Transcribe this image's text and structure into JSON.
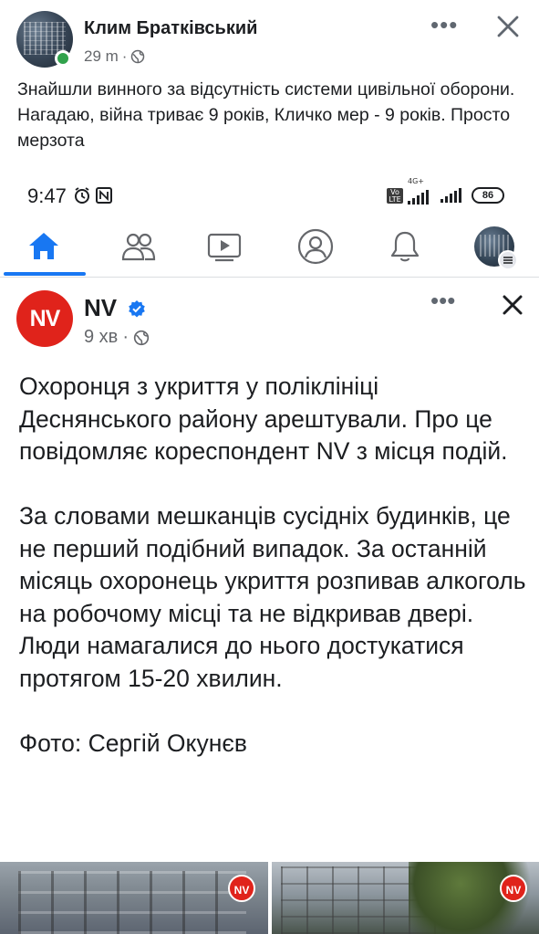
{
  "outer_post": {
    "author": "Клим Братківський",
    "time": "29 m",
    "separator": "·",
    "text": "Знайшли винного за відсутність системи цивільної оборони. Нагадаю, війна триває 9 років, Кличко мер - 9 років. Просто мерзота"
  },
  "status_bar": {
    "time": "9:47",
    "network": "4G+",
    "volte": "Vo LTE",
    "battery": "86"
  },
  "tabs": [
    {
      "name": "home",
      "icon": "home-icon",
      "active": true
    },
    {
      "name": "friends",
      "icon": "friends-icon"
    },
    {
      "name": "watch",
      "icon": "video-icon"
    },
    {
      "name": "profile",
      "icon": "profile-icon"
    },
    {
      "name": "notifications",
      "icon": "bell-icon"
    },
    {
      "name": "menu",
      "icon": "avatar-menu-icon"
    }
  ],
  "nv_post": {
    "logo_text": "NV",
    "page_name": "NV",
    "time": "9 хв",
    "separator": "·",
    "paragraph_1": "Охоронця з укриття у поліклініці Деснянського району арештували. Про це повідомляє кореспондент NV з місця подій.",
    "paragraph_2": "За словами мешканців сусідніх будинків, це не перший подібний випадок. За останній місяць охоронець укриття розпивав алкоголь на робочому місці та не відкривав двері. Люди намагалися до нього достукатися протягом 15-20 хвилин.",
    "paragraph_3": "Фото: Сергій Окунєв",
    "photo_badge": "NV"
  },
  "colors": {
    "accent": "#1877f2",
    "nv_red": "#e0231b",
    "online": "#31a24c",
    "meta_gray": "#65676b"
  }
}
